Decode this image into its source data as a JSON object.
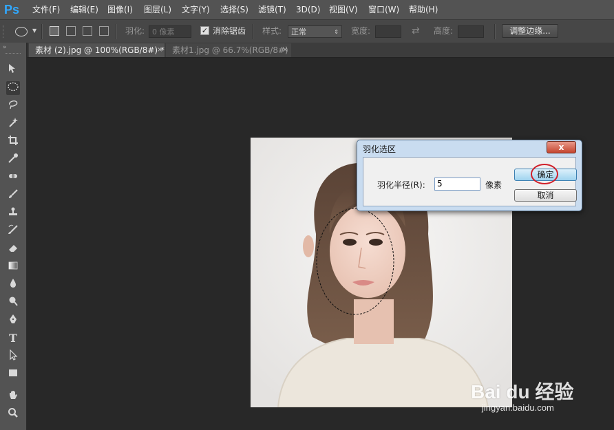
{
  "app": {
    "logo": "Ps"
  },
  "menu": [
    {
      "label": "文件(F)"
    },
    {
      "label": "编辑(E)"
    },
    {
      "label": "图像(I)"
    },
    {
      "label": "图层(L)"
    },
    {
      "label": "文字(Y)"
    },
    {
      "label": "选择(S)"
    },
    {
      "label": "滤镜(T)"
    },
    {
      "label": "3D(D)"
    },
    {
      "label": "视图(V)"
    },
    {
      "label": "窗口(W)"
    },
    {
      "label": "帮助(H)"
    }
  ],
  "options": {
    "feather_label": "羽化:",
    "feather_value": "0 像素",
    "antialias_label": "消除锯齿",
    "antialias_checked": true,
    "style_label": "样式:",
    "style_value": "正常",
    "width_label": "宽度:",
    "height_label": "高度:",
    "refine_edge": "调整边缘..."
  },
  "tabs": [
    {
      "label": "素材 (2).jpg @ 100%(RGB/8#) *",
      "close": "×",
      "active": true
    },
    {
      "label": "素材1.jpg @ 66.7%(RGB/8#)",
      "close": "×",
      "active": false
    }
  ],
  "tools": [
    "move-icon",
    "elliptical-marquee-icon",
    "lasso-icon",
    "magic-wand-icon",
    "crop-icon",
    "eyedropper-icon",
    "healing-brush-icon",
    "brush-icon",
    "clone-stamp-icon",
    "history-brush-icon",
    "eraser-icon",
    "gradient-icon",
    "blur-icon",
    "dodge-icon",
    "pen-icon",
    "type-icon",
    "path-selection-icon",
    "rectangle-shape-icon",
    "hand-icon",
    "zoom-icon"
  ],
  "type_tool_glyph": "T",
  "dialog": {
    "title": "羽化选区",
    "close": "x",
    "radius_label": "羽化半径(R):",
    "radius_value": "5",
    "unit": "像素",
    "ok": "确定",
    "cancel": "取消"
  },
  "watermark": {
    "text": "Bai du 经验",
    "url": "jingyan.baidu.com"
  },
  "colors": {
    "accent_ps": "#31a8ff",
    "highlight_circle": "#d0202a"
  }
}
